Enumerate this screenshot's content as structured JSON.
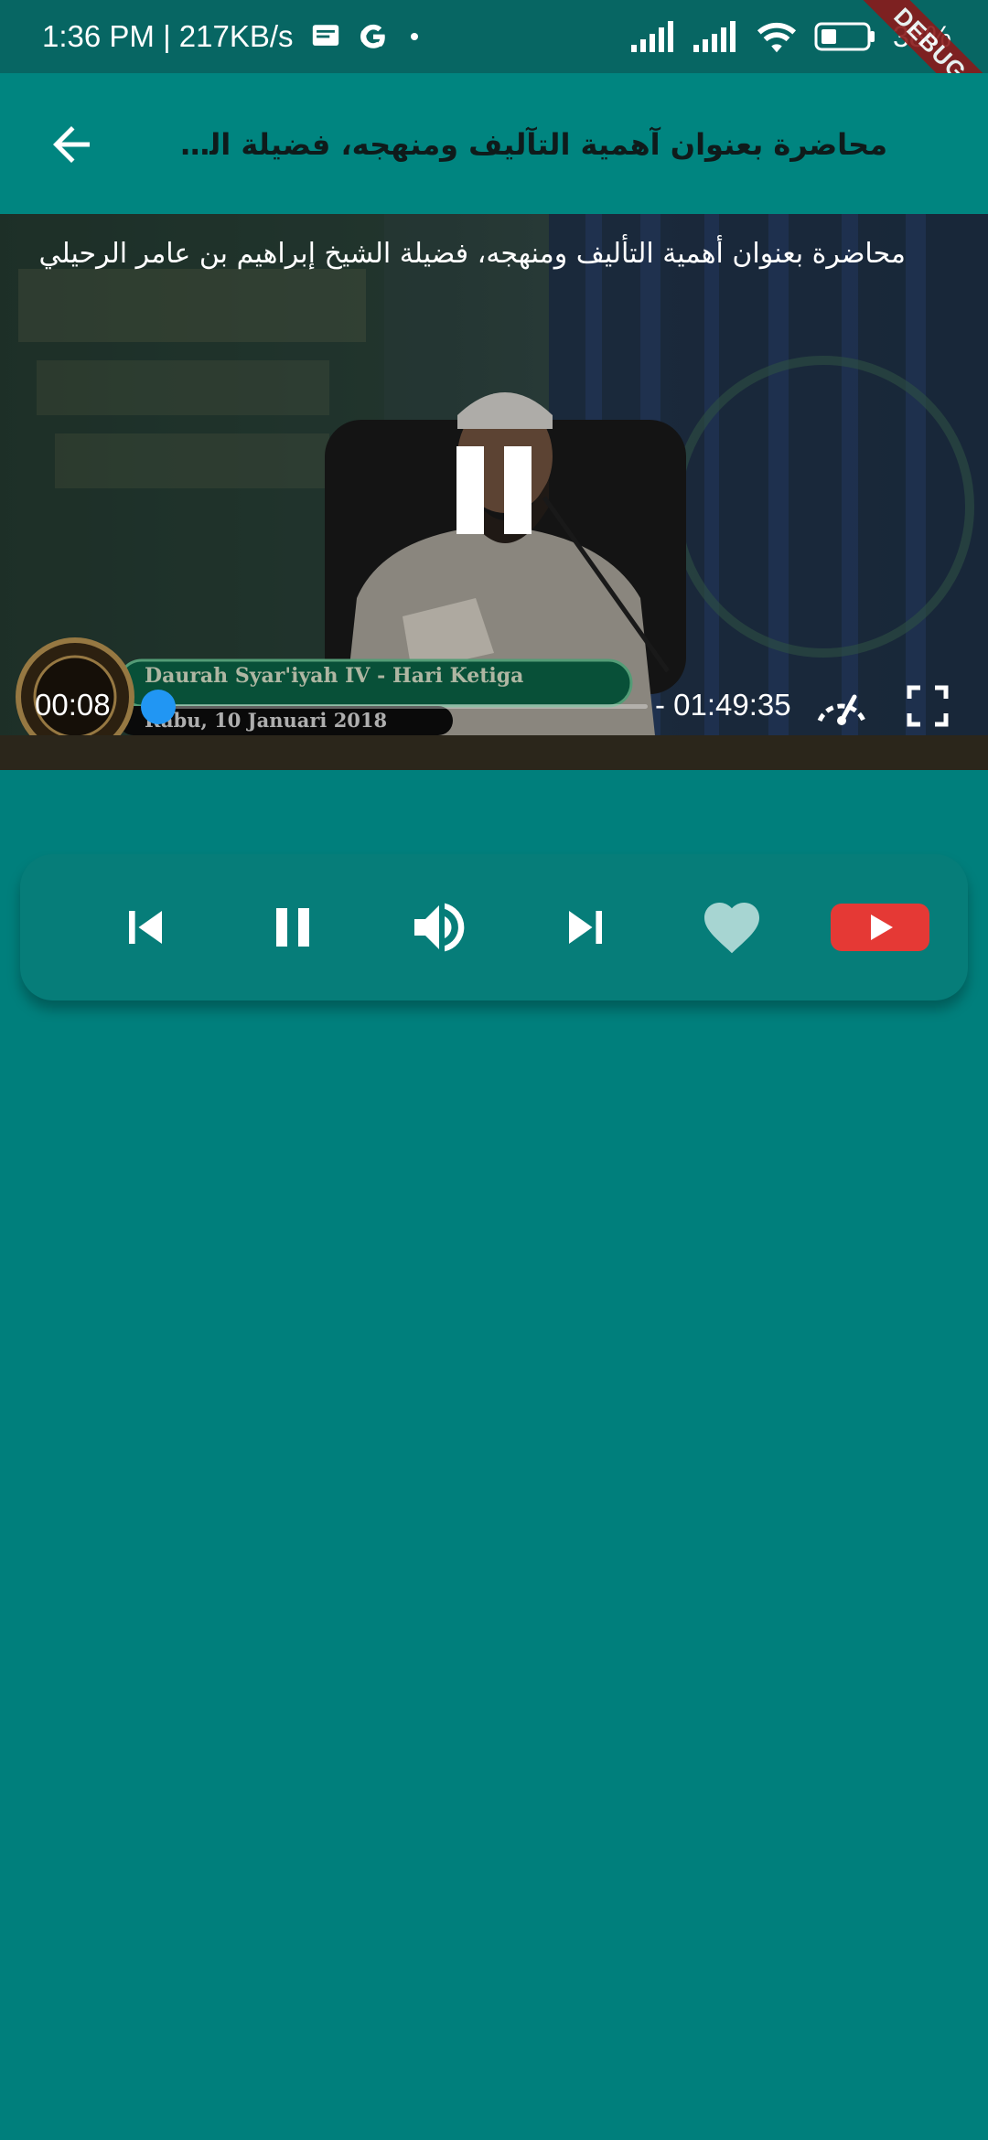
{
  "status_bar": {
    "time_speed": "1:36 PM | 217KB/s",
    "battery_pct": "38%",
    "debug_banner": "DEBUG"
  },
  "app_bar": {
    "title": "محاضرة بعنوان آهمية التآليف ومنهجه، فضيلة الشيخ …"
  },
  "video": {
    "overlay_title": "محاضرة بعنوان أهمية التأليف ومنهجه، فضيلة الشيخ إبراهيم بن عامر الرحيلي",
    "embedded_caption_line1": "Daurah Syar'iyah IV - Hari Ketiga",
    "embedded_caption_line2": "Rabu, 10 Januari 2018",
    "elapsed": "00:08",
    "remaining": "- 01:49:35",
    "progress": 0.01
  },
  "controls": {
    "items": [
      "skip-previous-icon",
      "pause-icon",
      "volume-icon",
      "skip-next-icon",
      "favorite-icon",
      "youtube-icon"
    ]
  },
  "colors": {
    "background": "#007f7c",
    "app_bar": "#008580",
    "status_bar": "#076663",
    "accent": "#2196f3",
    "youtube_red": "#e53935",
    "heart": "#a7d5d2"
  }
}
